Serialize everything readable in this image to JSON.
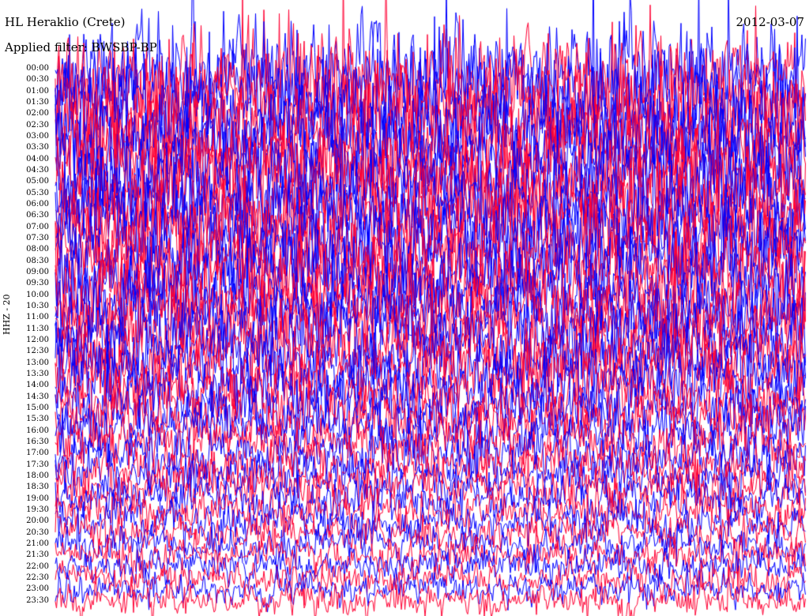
{
  "header": {
    "station": "HL Heraklio (Crete)",
    "date": "2012-03-07",
    "filter": "Applied filter: BWSBP-BP",
    "channel": "HHZ - 20"
  },
  "colors": {
    "trace_a": "#0000ff",
    "trace_b": "#ff0033",
    "background": "#ffffff"
  },
  "chart_data": {
    "type": "line",
    "title": "HL Heraklio (Crete)",
    "xlabel": "",
    "ylabel": "HHZ - 20",
    "row_labels": [
      "00:00",
      "00:30",
      "01:00",
      "01:30",
      "02:00",
      "02:30",
      "03:00",
      "03:30",
      "04:00",
      "04:30",
      "05:00",
      "05:30",
      "06:00",
      "06:30",
      "07:00",
      "07:30",
      "08:00",
      "08:30",
      "09:00",
      "09:30",
      "10:00",
      "10:30",
      "11:00",
      "11:30",
      "12:00",
      "12:30",
      "13:00",
      "13:30",
      "14:00",
      "14:30",
      "15:00",
      "15:30",
      "16:00",
      "16:30",
      "17:00",
      "17:30",
      "18:00",
      "18:30",
      "19:00",
      "19:30",
      "20:00",
      "20:30",
      "21:00",
      "21:30",
      "22:00",
      "22:30",
      "23:00",
      "23:30"
    ],
    "series_colors": [
      "#0000ff",
      "#ff0033"
    ],
    "relative_amplitude": [
      2.6,
      2.6,
      2.6,
      2.6,
      2.5,
      2.5,
      2.5,
      2.5,
      2.5,
      2.4,
      2.4,
      2.4,
      2.4,
      2.3,
      2.3,
      2.3,
      2.2,
      2.2,
      2.2,
      2.1,
      2.1,
      2.0,
      2.0,
      1.95,
      1.9,
      1.85,
      1.8,
      1.75,
      1.7,
      1.6,
      1.55,
      1.5,
      1.45,
      1.35,
      1.3,
      1.25,
      1.2,
      1.15,
      1.1,
      1.05,
      1.0,
      0.95,
      0.9,
      0.85,
      0.85,
      0.8,
      0.8,
      0.8
    ],
    "grid": false
  }
}
